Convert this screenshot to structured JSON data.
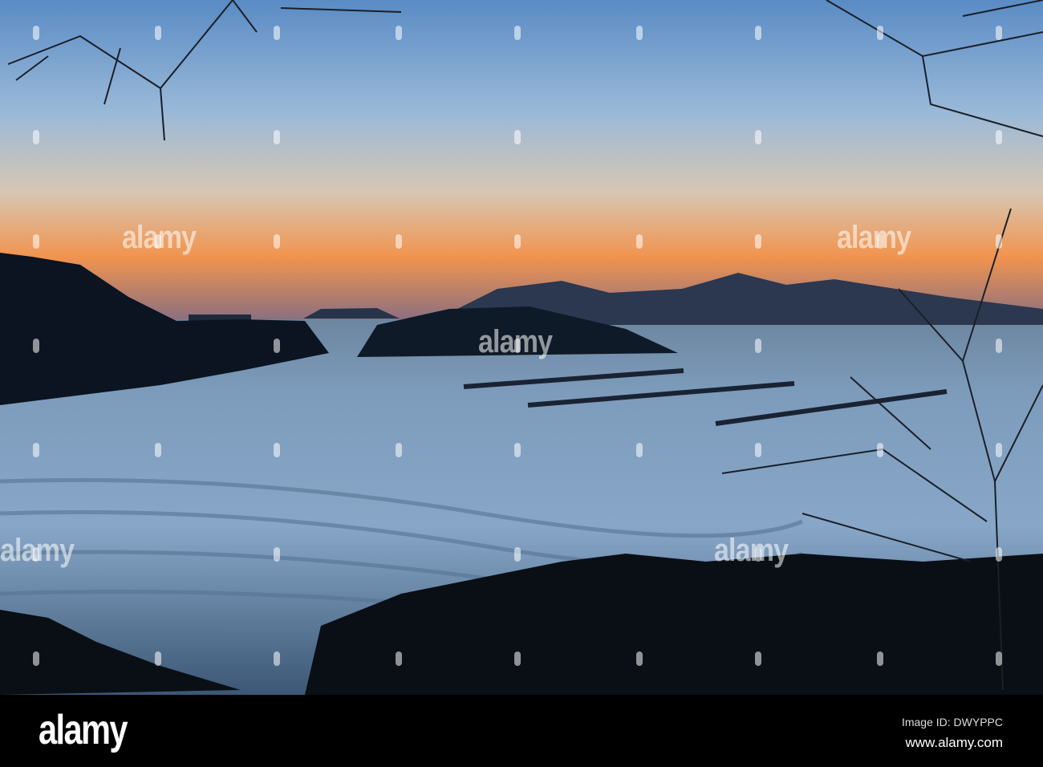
{
  "photo": {
    "subject": "sunset-bay"
  },
  "watermark": {
    "text": "alamy"
  },
  "footer": {
    "logo": "alamy",
    "image_id": "Image ID: DWYPPC",
    "site": "www.alamy.com"
  },
  "colors": {
    "sky_top": "#5b8cc6",
    "horizon": "#f2874a",
    "water": "#6f8fb0",
    "bar": "#000000"
  }
}
